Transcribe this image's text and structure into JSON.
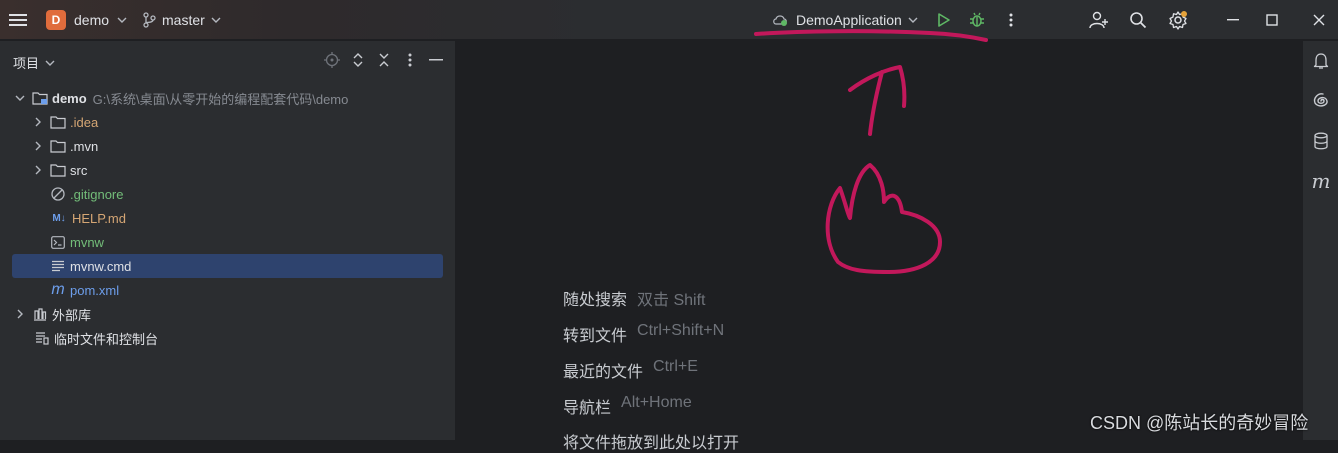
{
  "titlebar": {
    "project_badge": "D",
    "project_name": "demo",
    "branch": "master",
    "run_config": "DemoApplication"
  },
  "panel": {
    "title": "项目"
  },
  "tree": {
    "root": {
      "name": "demo",
      "path": "G:\\系统\\桌面\\从零开始的编程配套代码\\demo"
    },
    "idea": ".idea",
    "mvn": ".mvn",
    "src": "src",
    "gitignore": ".gitignore",
    "help_badge": "M↓",
    "help": "HELP.md",
    "mvnw": "mvnw",
    "mvnw_cmd": "mvnw.cmd",
    "pom_badge": "m",
    "pom": "pom.xml",
    "ext_libs": "外部库",
    "scratches": "临时文件和控制台"
  },
  "hints": [
    {
      "label": "随处搜索",
      "key": "双击 Shift"
    },
    {
      "label": "转到文件",
      "key": "Ctrl+Shift+N"
    },
    {
      "label": "最近的文件",
      "key": "Ctrl+E"
    },
    {
      "label": "导航栏",
      "key": "Alt+Home"
    },
    {
      "label": "将文件拖放到此处以打开",
      "key": ""
    }
  ],
  "right_strip": {
    "markdown_badge": "m"
  },
  "watermark": "CSDN @陈站长的奇妙冒险",
  "colors": {
    "accent_selection": "#2e436e",
    "run_green": "#5fb865",
    "annotation": "#c2185b",
    "project_badge": "#e06c3c"
  }
}
